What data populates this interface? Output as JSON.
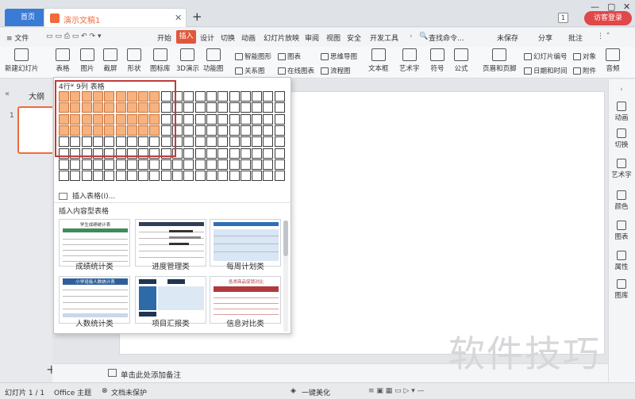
{
  "titlebar": {
    "home_tab": "首页",
    "doc_tab": "演示文稿1",
    "new_tab": "+",
    "badge": "1",
    "guest": "访客登录"
  },
  "menubar": {
    "file": "≡ 文件",
    "items": [
      "开始",
      "插入",
      "设计",
      "切换",
      "动画",
      "幻灯片放映",
      "审阅",
      "视图",
      "安全",
      "开发工具"
    ],
    "search": "查找命令...",
    "unsaved": "未保存",
    "share": "分享",
    "comment": "批注"
  },
  "ribbon": {
    "new_slide": "新建幻灯片",
    "table": "表格",
    "picture": "图片",
    "screenshot": "截屏",
    "shape": "形状",
    "icon_lib": "图标库",
    "3d": "3D演示",
    "func": "功能图",
    "smart_graphic": "智能图形",
    "chart": "图表",
    "relation": "关系图",
    "online_chart": "在线图表",
    "mindmap": "思维导图",
    "flowchart": "流程图",
    "textbox": "文本框",
    "wordart": "艺术字",
    "symbol": "符号",
    "formula": "公式",
    "header_footer": "页眉和页脚",
    "slide_number": "幻灯片编号",
    "datetime": "日期和时间",
    "object": "对象",
    "attachment": "附件",
    "audio": "音频"
  },
  "dropdown": {
    "grid_label": "4行* 9列 表格",
    "grid_rows_selected": 4,
    "grid_cols_selected": 9,
    "insert_table": "插入表格(I)...",
    "content_title": "插入内容型表格",
    "cards": [
      {
        "label": "成绩统计类",
        "title": "学生成绩统计表"
      },
      {
        "label": "进度管理类",
        "title": ""
      },
      {
        "label": "每周计划类",
        "title": ""
      },
      {
        "label": "人数统计类",
        "title": "小学班级人数统计表"
      },
      {
        "label": "项目汇报类",
        "title": ""
      },
      {
        "label": "信息对比类",
        "title": "各类商品促销对比"
      }
    ]
  },
  "sidepanel": {
    "outline": "大纲",
    "slide_num": "1"
  },
  "right_panel": [
    "动画",
    "切换",
    "艺术字",
    "颜色",
    "图表",
    "属性",
    "图库"
  ],
  "notes": "单击此处添加备注",
  "status": {
    "slide": "幻灯片 1 / 1",
    "theme": "Office 主题",
    "protect": "文档未保护",
    "beautify": "一键美化"
  },
  "watermark": "软件技巧"
}
